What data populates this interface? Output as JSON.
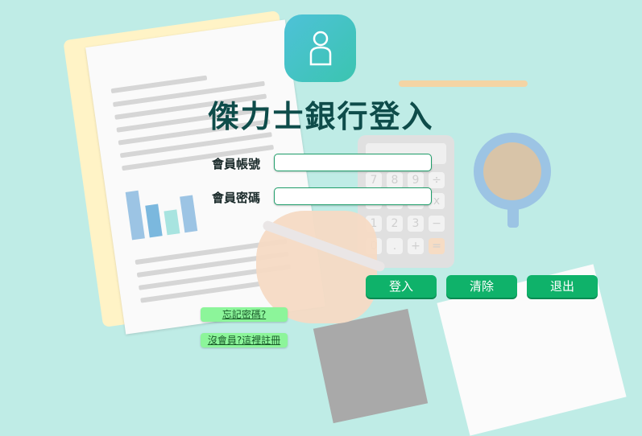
{
  "app_title": "傑力士銀行登入",
  "form": {
    "account_label": "會員帳號",
    "account_value": "",
    "password_label": "會員密碼",
    "password_value": ""
  },
  "buttons": {
    "login": "登入",
    "clear": "清除",
    "exit": "退出"
  },
  "links": {
    "forgot_password": "忘記密碼?",
    "register": "沒會員?這裡註冊"
  },
  "icons": {
    "logo": "user-icon"
  },
  "colors": {
    "background": "#bfece6",
    "title": "#0e4c4a",
    "button": "#0fb26a",
    "link_button": "#8cf59a",
    "logo_gradient_start": "#4ec2d8",
    "logo_gradient_end": "#3bc4b0"
  }
}
